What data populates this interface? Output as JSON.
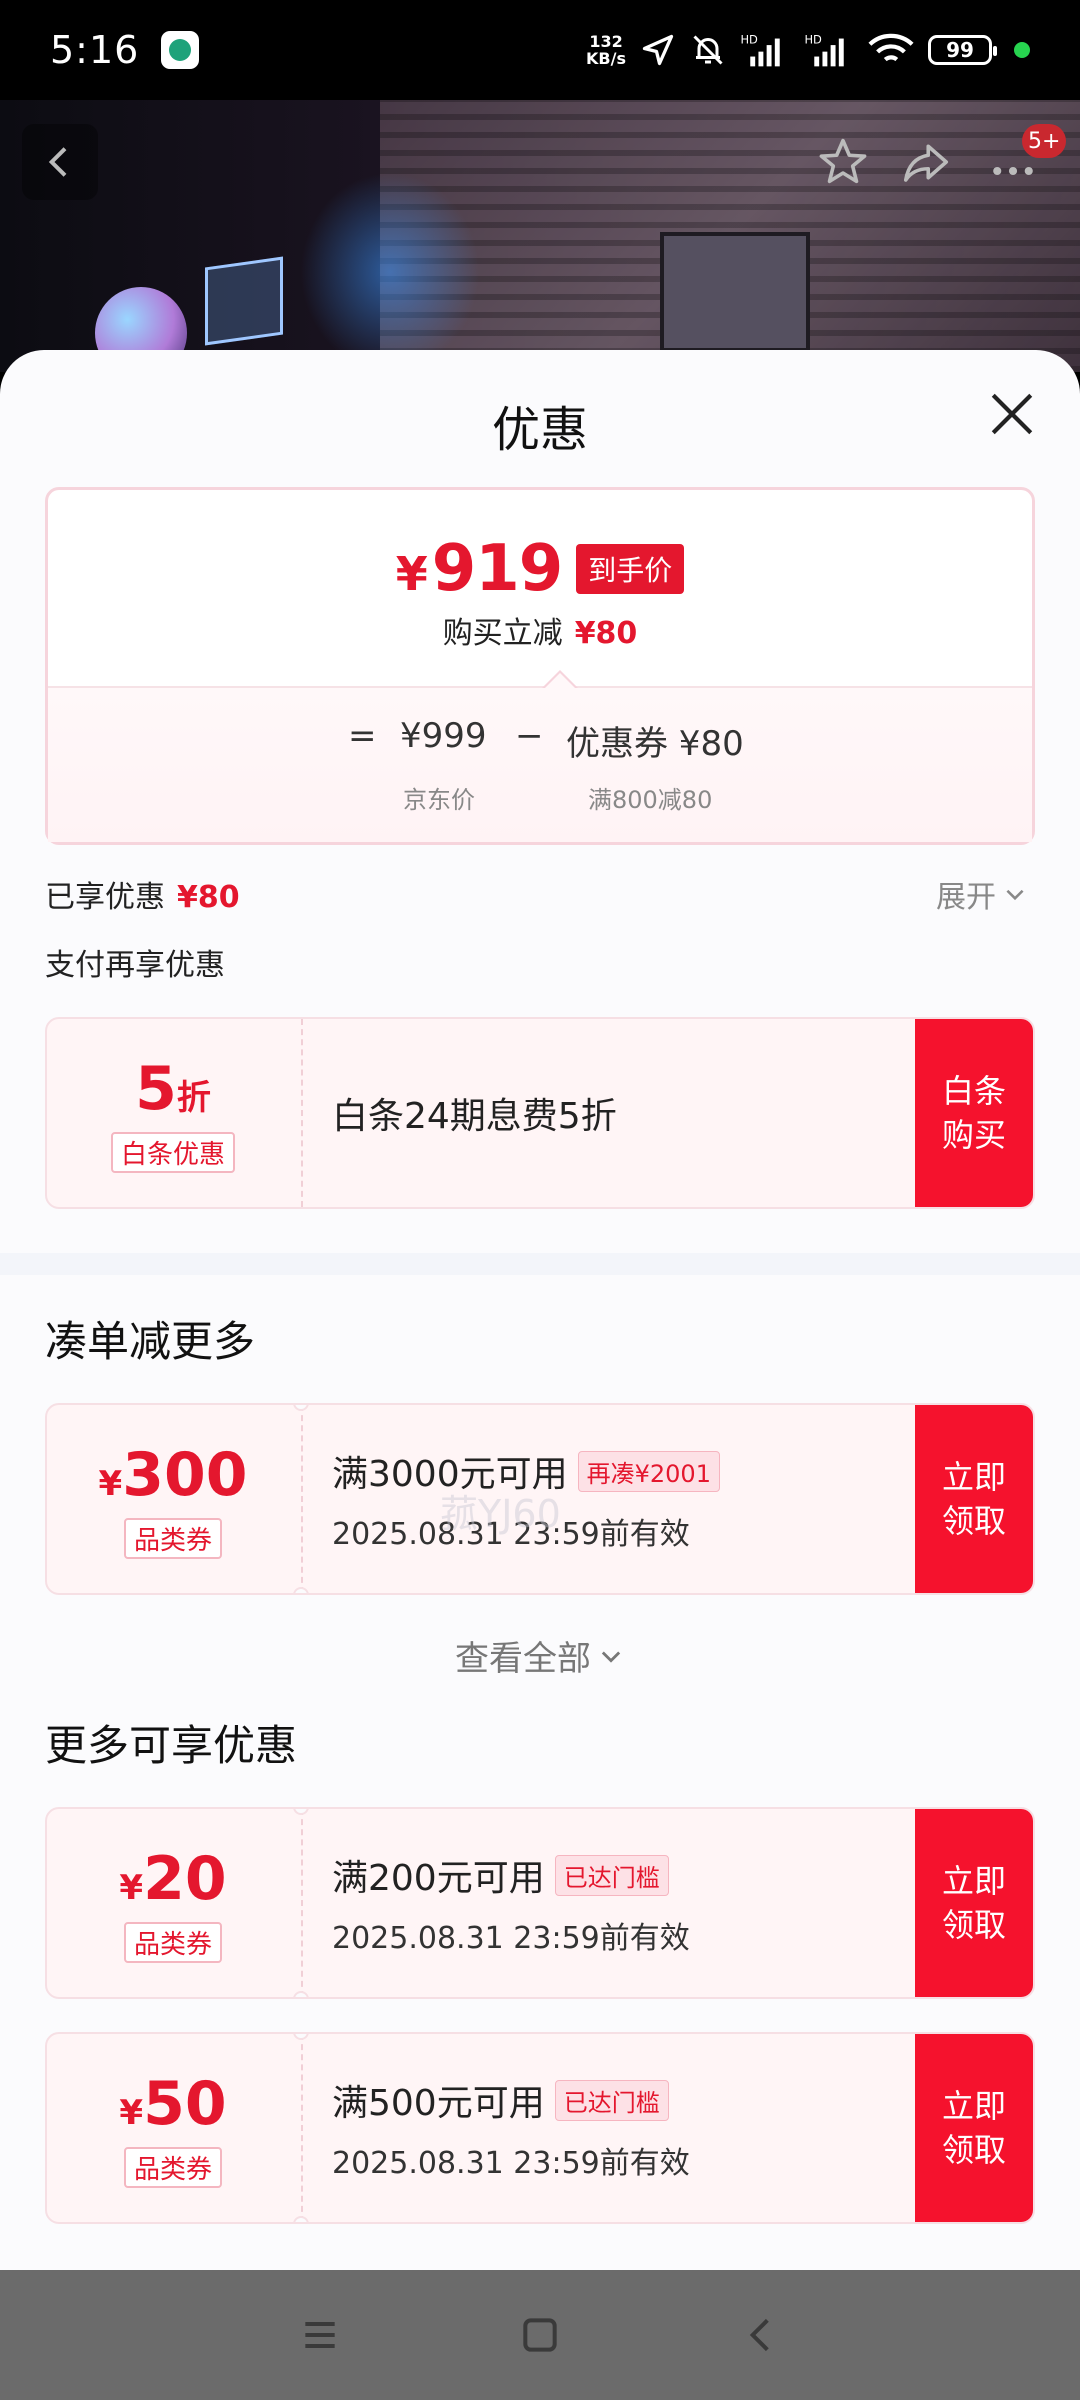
{
  "status_bar": {
    "time": "5:16",
    "net_speed_value": "132",
    "net_speed_unit": "KB/s",
    "signal_label_1": "HD",
    "signal_label_2": "HD",
    "battery": "99"
  },
  "header": {
    "cart_badge": "5+"
  },
  "sheet": {
    "title": "优惠",
    "price_card": {
      "currency": "¥",
      "final_price": "919",
      "final_price_tag": "到手价",
      "instant_discount_label": "购买立减",
      "instant_discount_value": "¥80",
      "equals": "=",
      "jd_price": "¥999",
      "minus": "−",
      "coupon_label": "优惠券 ¥80",
      "jd_price_caption": "京东价",
      "coupon_caption": "满800减80"
    },
    "enjoyed_label": "已享优惠",
    "enjoyed_value": "¥80",
    "expand_label": "展开",
    "pay_more_label": "支付再享优惠",
    "baitiao": {
      "amount": "5",
      "amount_unit": "折",
      "type": "白条优惠",
      "title": "白条24期息费5折",
      "action": "白条\n购买"
    },
    "watermark": "菰YJ60",
    "section_more_title": "凑单减更多",
    "coupons_main": [
      {
        "currency": "¥",
        "amount": "300",
        "type": "品类券",
        "title": "满3000元可用",
        "tag": "再凑¥2001",
        "validity": "2025.08.31 23:59前有效",
        "action": "立即\n领取"
      }
    ],
    "view_all_label": "查看全部",
    "section_extra_title": "更多可享优惠",
    "coupons_extra": [
      {
        "currency": "¥",
        "amount": "20",
        "type": "品类券",
        "title": "满200元可用",
        "tag": "已达门槛",
        "validity": "2025.08.31 23:59前有效",
        "action": "立即\n领取"
      },
      {
        "currency": "¥",
        "amount": "50",
        "type": "品类券",
        "title": "满500元可用",
        "tag": "已达门槛",
        "validity": "2025.08.31 23:59前有效",
        "action": "立即\n领取"
      }
    ]
  },
  "colors": {
    "accent_red": "#e4172e",
    "button_red": "#f5122d",
    "coupon_bg": "#fff5f6"
  },
  "icons": [
    "back-icon",
    "star-icon",
    "share-icon",
    "more-icon",
    "close-icon",
    "chevron-down-icon",
    "menu-icon",
    "home-icon",
    "nav-back-icon"
  ]
}
